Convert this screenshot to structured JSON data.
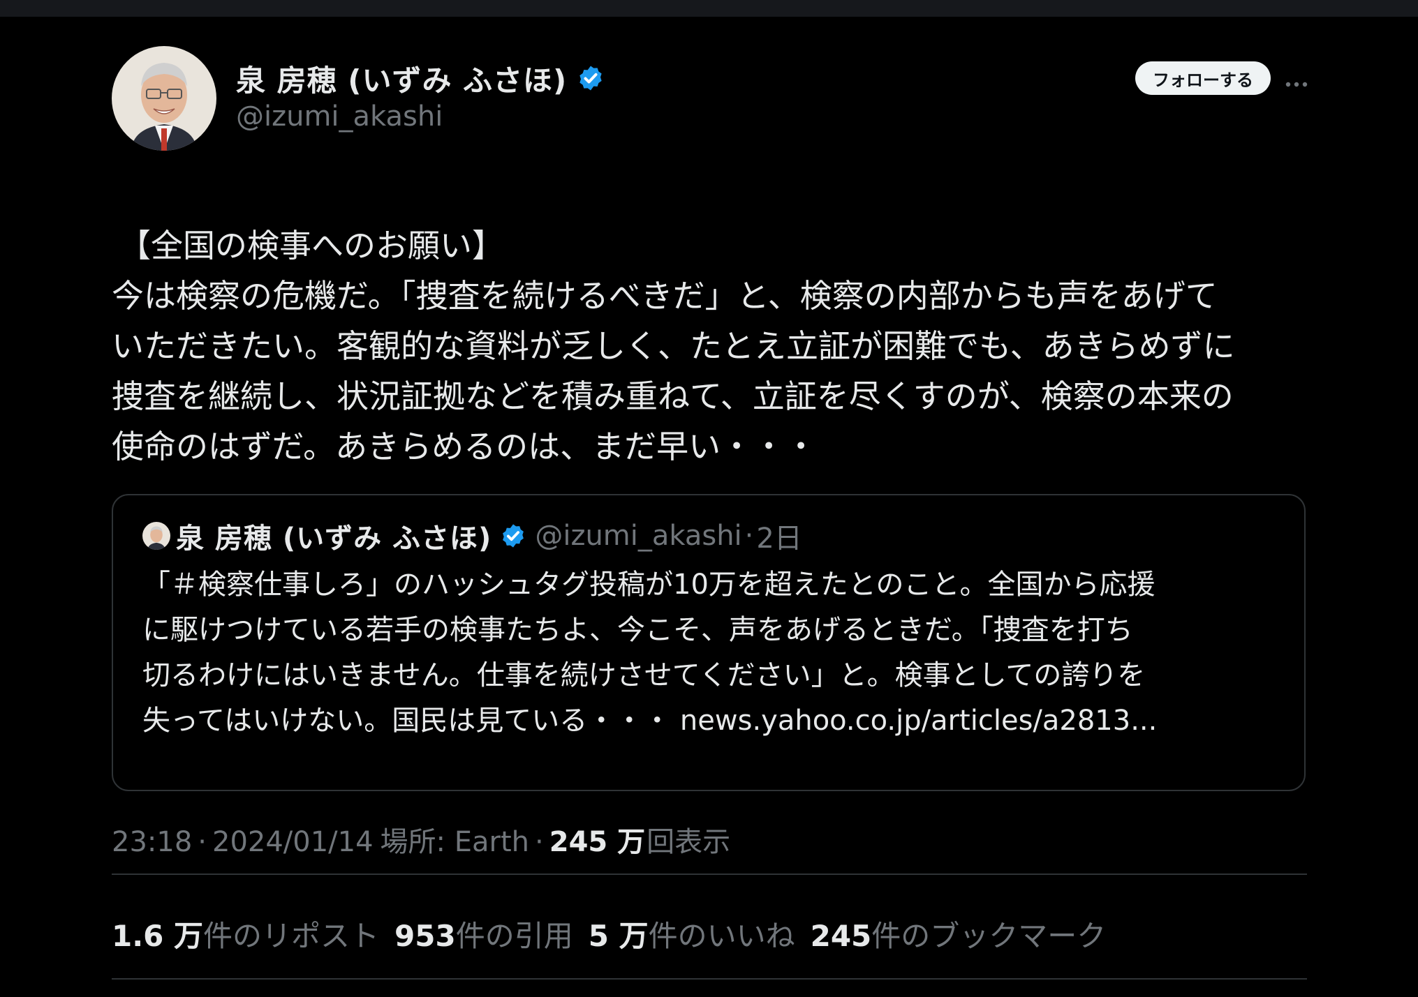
{
  "author": {
    "display_name": "泉 房穂 (いずみ ふさほ)",
    "handle": "@izumi_akashi",
    "avatar_icon": "avatar-photo",
    "verified_icon": "verified-badge-icon",
    "verified_color": "#1d9bf0"
  },
  "header": {
    "follow_label": "フォローする",
    "more_icon": "more-icon"
  },
  "tweet": {
    "lines": [
      "【全国の検事へのお願い】",
      "今は検察の危機だ。「捜査を続けるべきだ」と、検察の内部からも声をあげて",
      "いただきたい。客観的な資料が乏しく、たとえ立証が困難でも、あきらめずに",
      "捜査を継続し、状況証拠などを積み重ねて、立証を尽くすのが、検察の本来の",
      "使命のはずだ。あきらめるのは、まだ早い・・・"
    ]
  },
  "quote": {
    "display_name": "泉 房穂 (いずみ ふさほ)",
    "handle": "@izumi_akashi",
    "separator": "·",
    "time": "2日",
    "lines": [
      "「＃検察仕事しろ」のハッシュタグ投稿が10万を超えたとのこと。全国から応援",
      "に駆けつけている若手の検事たちよ、今こそ、声をあげるときだ。「捜査を打ち",
      "切るわけにはいきません。仕事を続けさせてください」と。検事としての誇りを"
    ],
    "last_line_text": "失ってはいけない。国民は見ている・・・ ",
    "link_text": "news.yahoo.co.jp/articles/a2813..."
  },
  "meta": {
    "time": "23:18",
    "separator": "·",
    "date": "2024/01/14",
    "location": "場所: Earth",
    "views_count": "245 万",
    "views_label": "回表示"
  },
  "stats": [
    {
      "count": "1.6 万",
      "label": "件のリポスト"
    },
    {
      "count": "953",
      "label": "件の引用"
    },
    {
      "count": "5 万",
      "label": "件のいいね"
    },
    {
      "count": "245",
      "label": "件のブックマーク"
    }
  ],
  "colors": {
    "background": "#000000",
    "text_primary": "#e7e9ea",
    "text_secondary": "#71767b",
    "border": "#2f3336",
    "accent": "#1d9bf0"
  }
}
